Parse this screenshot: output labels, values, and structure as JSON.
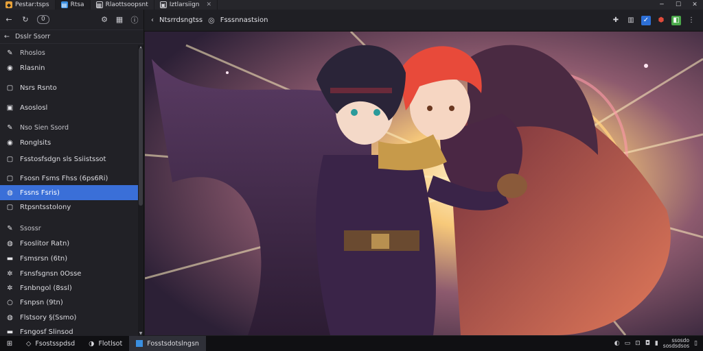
{
  "tabs": [
    {
      "label": "Pestar:tsps",
      "icon": "app-icon",
      "color": "#e8a23a",
      "active": false
    },
    {
      "label": "Rtsa",
      "icon": "page-icon",
      "color": "#3a8fe0",
      "active": true
    },
    {
      "label": "Rlaottsoopsnt",
      "icon": "document-icon",
      "color": "#cfcfd4",
      "active": false
    },
    {
      "label": "Iztlarsiign",
      "icon": "image-icon",
      "color": "#cfcfd4",
      "active": false
    }
  ],
  "window_controls": [
    "─",
    "☐",
    "✕"
  ],
  "sidebar": {
    "toolbar_pill": "0",
    "back_label": "Dsslr Ssorr",
    "items": [
      {
        "label": "Rhoslos",
        "icon": "tool-icon",
        "type": "header"
      },
      {
        "label": "Rlasnin",
        "icon": "brush-icon",
        "type": "item"
      },
      {
        "label": "Nsrs Rsnto",
        "icon": "frame-icon",
        "type": "item"
      },
      {
        "label": "Asoslosl",
        "icon": "image-icon",
        "type": "item"
      },
      {
        "label": "Nso Sien Ssord",
        "icon": "tool-icon",
        "type": "header"
      },
      {
        "label": "Ronglsits",
        "icon": "brush-icon",
        "type": "item"
      },
      {
        "label": "Fsstosfsdgn sls Ssiistssot",
        "icon": "frame-icon",
        "type": "item"
      },
      {
        "label": "Fsosn Fsms Fhss (6ps6Ri)",
        "icon": "frame-icon",
        "type": "item"
      },
      {
        "label": "Fssns Fsris)",
        "icon": "check-icon",
        "type": "item",
        "selected": true
      },
      {
        "label": "Rtpsntsstolony",
        "icon": "frame-icon",
        "type": "item"
      },
      {
        "label": "Ssossr",
        "icon": "tool-icon",
        "type": "header"
      },
      {
        "label": "Fsoslitor Ratn)",
        "icon": "check-icon",
        "type": "item"
      },
      {
        "label": "Fsmsrsn (6tn)",
        "icon": "layer-icon",
        "type": "item"
      },
      {
        "label": "Fsnsfsgnsn 0Osse",
        "icon": "gear-icon",
        "type": "item"
      },
      {
        "label": "Fsnbngol (8ssl)",
        "icon": "gear-icon",
        "type": "item"
      },
      {
        "label": "Fsnpsn (9tn)",
        "icon": "circle-icon",
        "type": "item"
      },
      {
        "label": "Flstsory §(Ssmo)",
        "icon": "check-icon",
        "type": "item"
      },
      {
        "label": "Fsngosf Slinsod",
        "icon": "layer-icon",
        "type": "item"
      }
    ]
  },
  "content": {
    "breadcrumb": "Ntsrrdsngtss",
    "status": "Fsssnnastsion"
  },
  "taskbar": {
    "items": [
      {
        "label": "Fsostsspdsd",
        "icon": "folder-icon",
        "active": false
      },
      {
        "label": "Flotlsot",
        "icon": "timer-icon",
        "active": false
      },
      {
        "label": "Fosstsdotslngsn",
        "icon": "app-icon",
        "active": true
      }
    ],
    "clock_time": "ssosdo",
    "clock_date": "sosdsdsos"
  },
  "colors": {
    "accent": "#3a6fd8",
    "background": "#1e1e22",
    "panel": "#212126"
  }
}
